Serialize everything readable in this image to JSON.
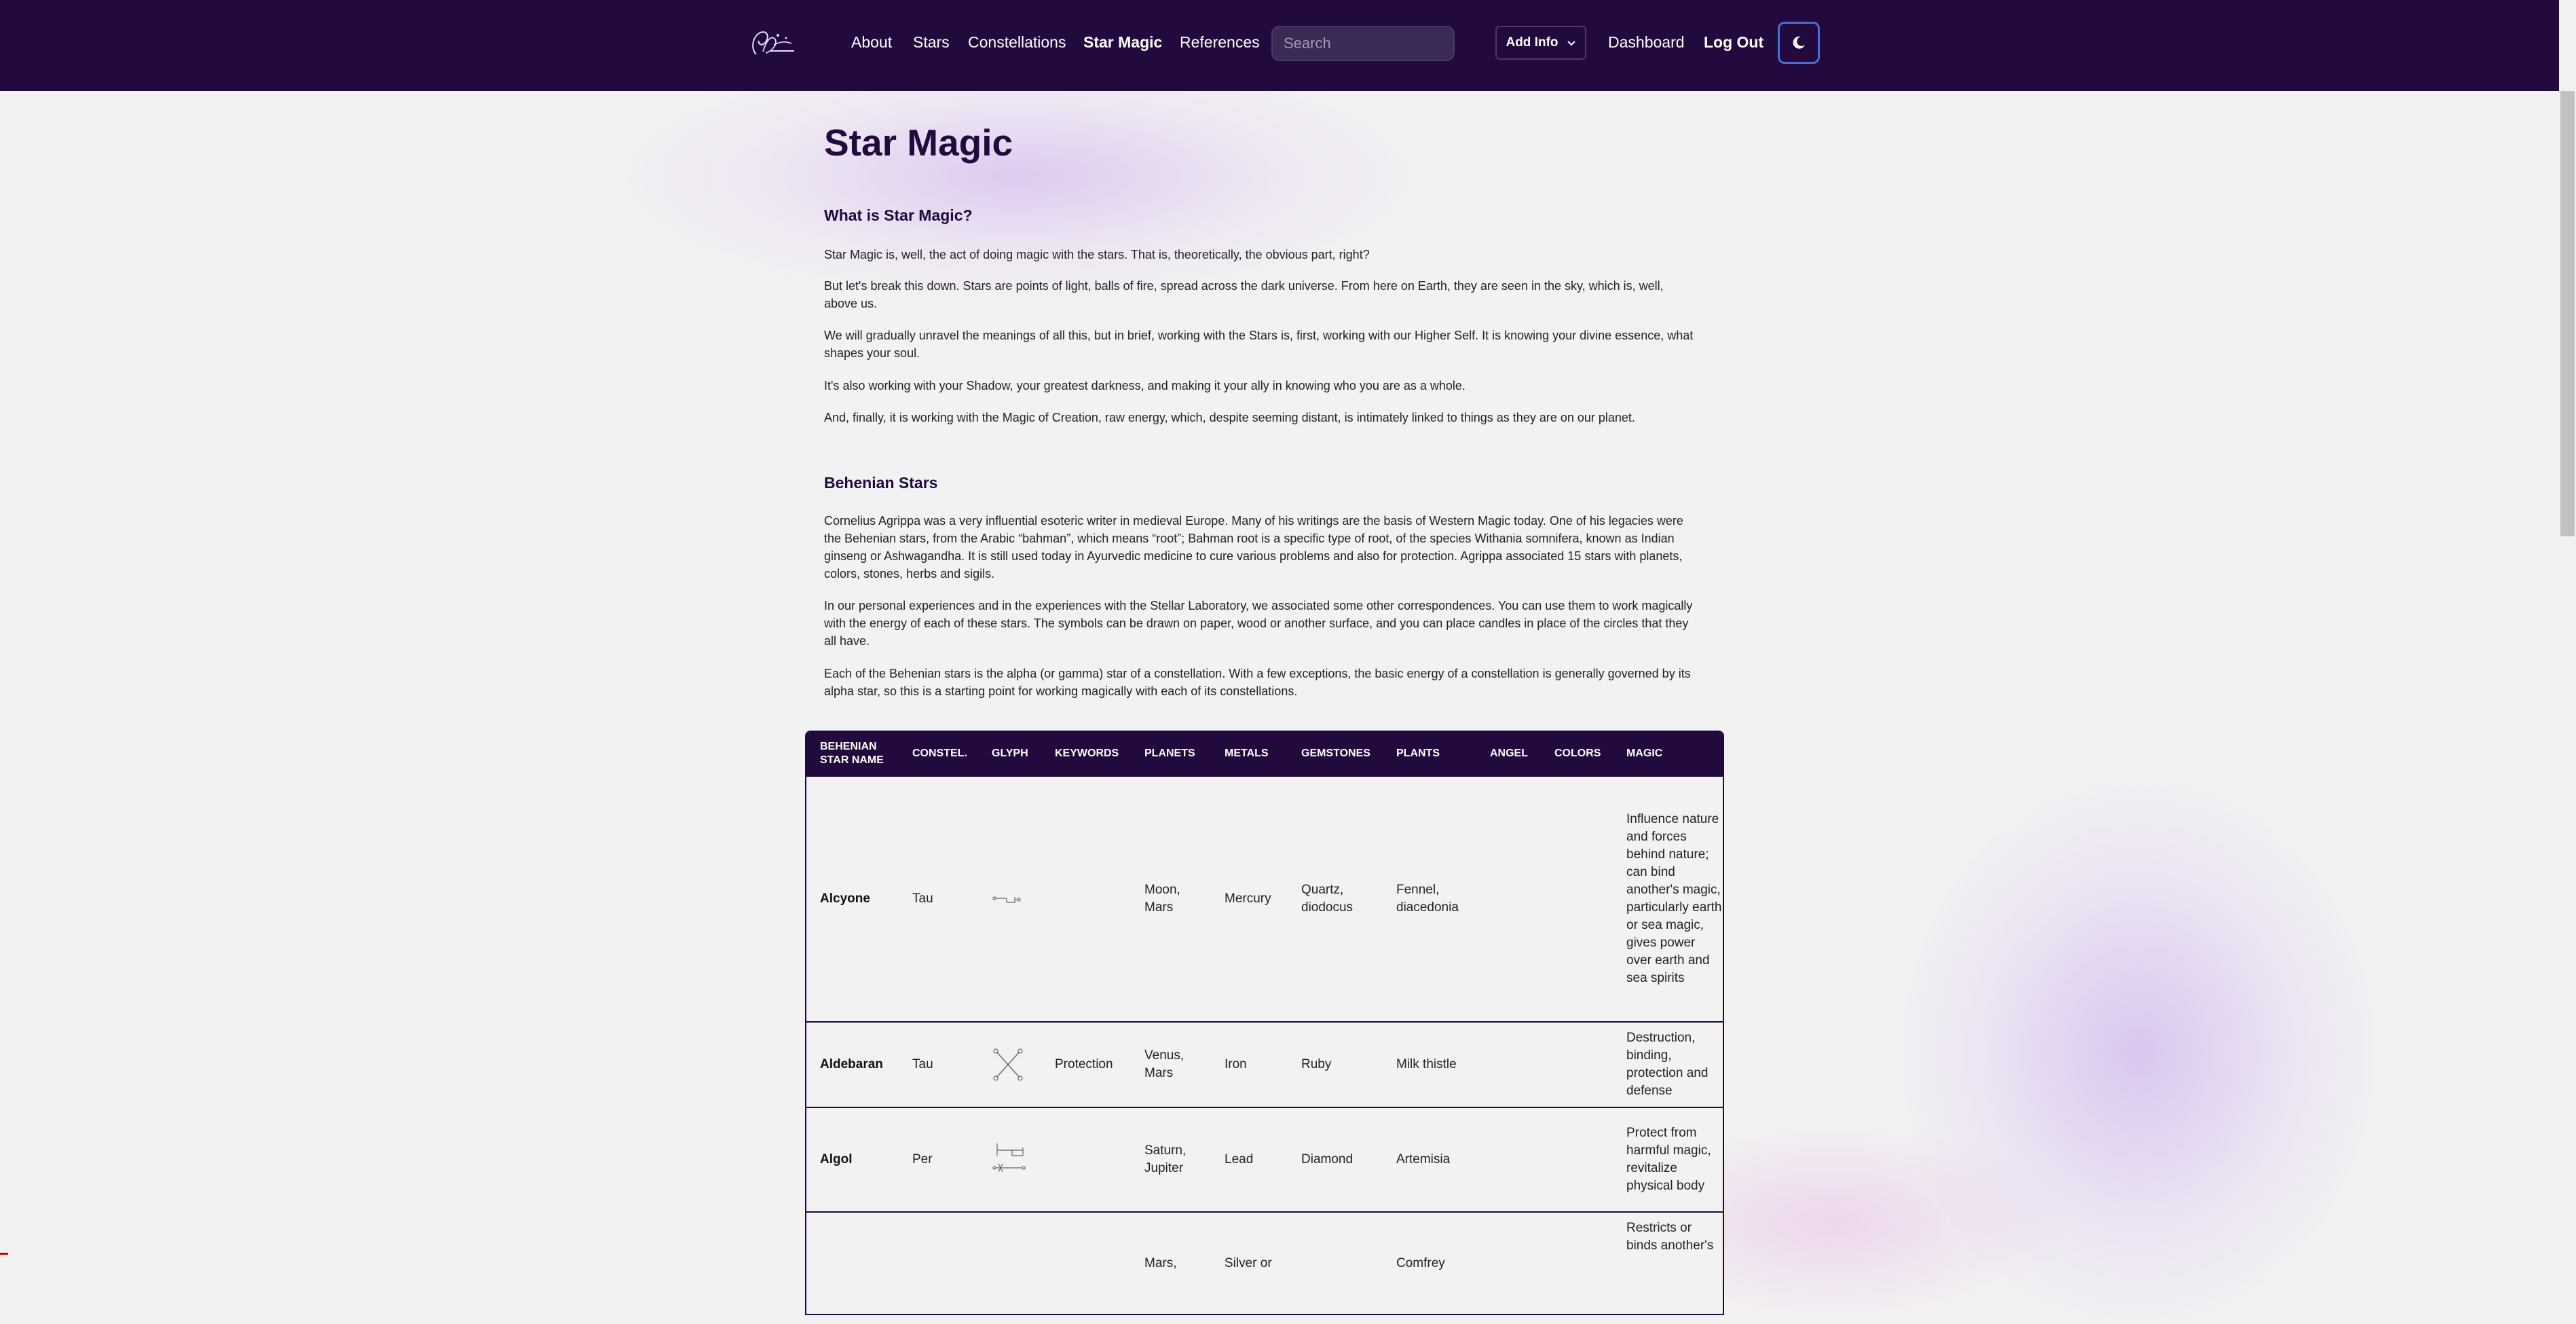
{
  "nav": {
    "links": [
      "About",
      "Stars",
      "Constellations",
      "Star Magic",
      "References"
    ],
    "active": "Star Magic",
    "search_placeholder": "Search",
    "add_info_label": "Add Info",
    "dashboard_label": "Dashboard",
    "logout_label": "Log Out",
    "theme_icon": "moon-icon"
  },
  "page": {
    "title": "Star Magic",
    "section1_heading": "What is Star Magic?",
    "section1_paragraphs": [
      "Star Magic is, well, the act of doing magic with the stars. That is, theoretically, the obvious part, right?",
      "But let's break this down. Stars are points of light, balls of fire, spread across the dark universe. From here on Earth, they are seen in the sky, which is, well, above us.",
      "We will gradually unravel the meanings of all this, but in brief, working with the Stars is, first, working with our Higher Self. It is knowing your divine essence, what shapes your soul.",
      "It's also working with your Shadow, your greatest darkness, and making it your ally in knowing who you are as a whole.",
      "And, finally, it is working with the Magic of Creation, raw energy, which, despite seeming distant, is intimately linked to things as they are on our planet."
    ],
    "section2_heading": "Behenian Stars",
    "section2_paragraphs": [
      "Cornelius Agrippa was a very influential esoteric writer in medieval Europe. Many of his writings are the basis of Western Magic today. One of his legacies were the Behenian stars, from the Arabic “bahman”, which means “root”; Bahman root is a specific type of root, of the species Withania somnifera, known as Indian ginseng or Ashwagandha. It is still used today in Ayurvedic medicine to cure various problems and also for protection. Agrippa associated 15 stars with planets, colors, stones, herbs and sigils.",
      "In our personal experiences and in the experiences with the Stellar Laboratory, we associated some other correspondences. You can use them to work magically with the energy of each of these stars. The symbols can be drawn on paper, wood or another surface, and you can place candles in place of the circles that they all have.",
      "Each of the Behenian stars is the alpha (or gamma) star of a constellation. With a few exceptions, the basic energy of a constellation is generally governed by its alpha star, so this is a starting point for working magically with each of its constellations."
    ]
  },
  "table": {
    "headers": [
      "Behenian Star Name",
      "Constel.",
      "Glyph",
      "Keywords",
      "Planets",
      "Metals",
      "Gemstones",
      "Plants",
      "Angel",
      "Colors",
      "Magic"
    ],
    "rows": [
      {
        "name": "Alcyone",
        "constel": "Tau",
        "glyph": "alcyone-glyph-icon",
        "keywords": "",
        "planets": "Moon, Mars",
        "metals": "Mercury",
        "gemstones": "Quartz, diodocus",
        "plants": "Fennel, diacedonia",
        "angel": "",
        "colors": "",
        "magic": "Influence nature and forces behind nature; can bind another's magic, particularly earth or sea magic, gives power over earth and sea spirits"
      },
      {
        "name": "Aldebaran",
        "constel": "Tau",
        "glyph": "aldebaran-glyph-icon",
        "keywords": "Protection",
        "planets": "Venus, Mars",
        "metals": "Iron",
        "gemstones": "Ruby",
        "plants": "Milk thistle",
        "angel": "",
        "colors": "",
        "magic": "Destruction, binding, protection and defense"
      },
      {
        "name": "Algol",
        "constel": "Per",
        "glyph": "algol-glyph-icon",
        "keywords": "",
        "planets": "Saturn, Jupiter",
        "metals": "Lead",
        "gemstones": "Diamond",
        "plants": "Artemisia",
        "angel": "",
        "colors": "",
        "magic": "Protect from harmful magic, revitalize physical body"
      },
      {
        "name": "",
        "constel": "",
        "glyph": "",
        "keywords": "",
        "planets": "Mars,",
        "metals": "Silver or",
        "gemstones": "",
        "plants": "Comfrey",
        "angel": "",
        "colors": "",
        "magic": "Restricts or binds another's"
      }
    ]
  },
  "colors": {
    "navbar_bg": "#22093e",
    "heading": "#22093e",
    "page_bg": "#f2f2f2",
    "theme_border": "#4a6fd6"
  }
}
